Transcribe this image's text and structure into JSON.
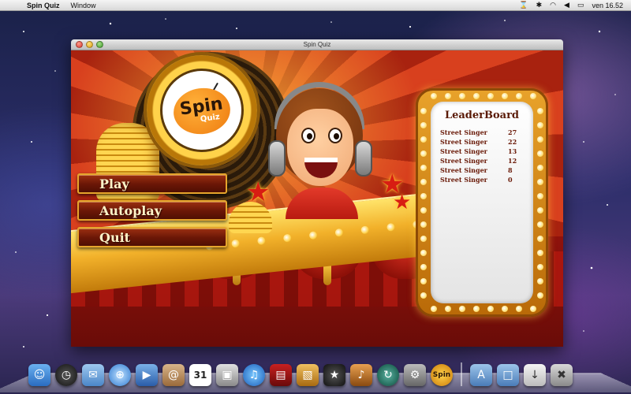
{
  "menubar": {
    "apple_glyph": "",
    "app_name": "Spin Quiz",
    "menus": [
      "Window"
    ],
    "status_icons": [
      "time-machine-icon",
      "bluetooth-icon",
      "wifi-icon",
      "volume-icon",
      "battery-icon"
    ],
    "clock": "ven 16.52"
  },
  "window": {
    "title": "Spin Quiz"
  },
  "game": {
    "logo": {
      "word1": "Spin",
      "word2": "Quiz"
    },
    "menu": {
      "play_label": "Play",
      "autoplay_label": "Autoplay",
      "quit_label": "Quit"
    },
    "leaderboard": {
      "title": "LeaderBoard",
      "rows": [
        {
          "name": "Street Singer",
          "score": "27"
        },
        {
          "name": "Street Singer",
          "score": "22"
        },
        {
          "name": "Street Singer",
          "score": "13"
        },
        {
          "name": "Street Singer",
          "score": "12"
        },
        {
          "name": "Street Singer",
          "score": "8"
        },
        {
          "name": "Street Singer",
          "score": "0"
        }
      ]
    }
  },
  "dock": {
    "items": [
      "finder-icon",
      "dashboard-icon",
      "mail-icon",
      "safari-icon",
      "facetime-icon",
      "address-book-icon",
      "ical-icon",
      "iphoto-icon",
      "itunes-icon",
      "photo-booth-icon",
      "preview-icon",
      "imovie-icon",
      "garageband-icon",
      "time-machine-icon",
      "system-preferences-icon",
      "spin-quiz-icon",
      "applications-folder-icon",
      "documents-folder-icon",
      "downloads-stack-icon",
      "trash-icon"
    ],
    "spin_quiz_label": "Spin",
    "calendar_day": "31"
  },
  "colors": {
    "accent_gold": "#e6a52c",
    "button_fill": "#6a1606",
    "leaderboard_text": "#6a1a08"
  }
}
